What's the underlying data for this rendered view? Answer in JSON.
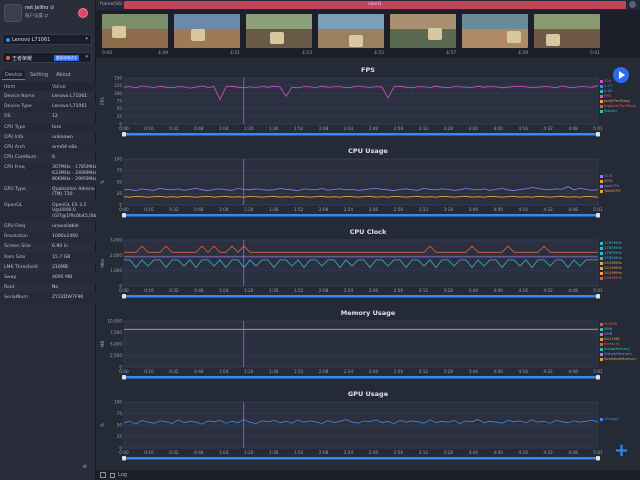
{
  "profile": {
    "name": "net Jeliho ⊙",
    "subtitle": "账户设置 ⇄"
  },
  "device_select": "Lenovo L71061",
  "app_select": "王者荣耀",
  "app_tag": "整游戏测试中",
  "tabs": [
    "Device",
    "Setting",
    "About"
  ],
  "table_header": {
    "item": "Item",
    "value": "Value"
  },
  "device_info": [
    {
      "k": "Device Name",
      "v": [
        "Lenovo L71061"
      ]
    },
    {
      "k": "Device Type",
      "v": [
        "Lenovo L71061"
      ]
    },
    {
      "k": "OS",
      "v": [
        "12"
      ]
    },
    {
      "k": "CPU Type",
      "v": [
        "toro"
      ]
    },
    {
      "k": "CPU Info",
      "v": [
        "unknown"
      ]
    },
    {
      "k": "CPU Arch",
      "v": [
        "arm64-v8a"
      ]
    },
    {
      "k": "CPU CoreNum",
      "v": [
        "8"
      ]
    },
    {
      "k": "CPU Freq",
      "v": [
        "307MHz - 1785MHz",
        "633MHz - 2496MHz",
        "806MHz - 2995MHz"
      ]
    },
    {
      "k": "GPU Type",
      "v": [
        "Qualcomm Adreno",
        "(TM) 730"
      ]
    },
    {
      "k": "OpenGL",
      "v": [
        "OpenGL ES 3.2",
        "V@0000.0",
        "(GIT@1f9c0b45,I0b4f"
      ]
    },
    {
      "k": "GPU Freq",
      "v": [
        "unavailable"
      ]
    },
    {
      "k": "Resolution",
      "v": [
        "1080x2460"
      ]
    },
    {
      "k": "Screen Size",
      "v": [
        "6.90 in"
      ]
    },
    {
      "k": "Ram Size",
      "v": [
        "15.7 GB"
      ]
    },
    {
      "k": "LMK Threshold",
      "v": [
        "216MB"
      ]
    },
    {
      "k": "Swap",
      "v": [
        "4095 MB"
      ]
    },
    {
      "k": "Root",
      "v": [
        "No"
      ]
    },
    {
      "k": "SerialNum",
      "v": [
        "ZY22DW7F9K"
      ]
    }
  ],
  "timeline": {
    "label": "frame(56)",
    "segment": "label1",
    "thumb_times": [
      "4:49",
      "4:51",
      "4:53",
      "4:55",
      "4:57",
      "4:59",
      "5:01"
    ],
    "offsets": [
      "0:00",
      "0:00"
    ]
  },
  "x_ticks": [
    "0:00",
    "0:16",
    "0:32",
    "0:48",
    "1:04",
    "1:20",
    "1:36",
    "1:52",
    "2:08",
    "2:24",
    "2:40",
    "2:56",
    "3:12",
    "3:28",
    "3:44",
    "4:00",
    "4:16",
    "4:32",
    "4:48",
    "5:01"
  ],
  "log_label": "Log",
  "chart_data": [
    {
      "type": "line",
      "title": "FPS",
      "ylabel": "FPS",
      "ylim": [
        0,
        150
      ],
      "yticks": [
        "150",
        "125",
        "100",
        "75",
        "50",
        "25",
        "0"
      ],
      "series": [
        {
          "name": "FPS",
          "color": "#d94fd2",
          "values": [
            120,
            122,
            118,
            124,
            121,
            119,
            123,
            120,
            118,
            122,
            121,
            117,
            120,
            124,
            119,
            122,
            80,
            121,
            123,
            120,
            118,
            121,
            119,
            122,
            120,
            123,
            121,
            90,
            120,
            118,
            122,
            121,
            119,
            123,
            120,
            121,
            122,
            118,
            120,
            124,
            121,
            119,
            122,
            120,
            85,
            121,
            123,
            120,
            118,
            122,
            121,
            119,
            123,
            120,
            118,
            122,
            121,
            120,
            119,
            123,
            120,
            122,
            121,
            118,
            120,
            122,
            123,
            121,
            119,
            120,
            122,
            121,
            118,
            124,
            120,
            119,
            122,
            121,
            120,
            125
          ]
        }
      ],
      "legend": [
        {
          "text": "120",
          "color": "#d94fd2"
        },
        {
          "text": "0.07",
          "color": "#2f8cf3"
        },
        {
          "text": "0.02",
          "color": "#2fc6a8"
        },
        {
          "text": "FPS",
          "color": "#d94fd2"
        },
        {
          "text": "Jank(PerfDog)",
          "color": "#f0a040"
        },
        {
          "text": "BigJank(PerfDog)",
          "color": "#e05555"
        },
        {
          "text": "Stutter",
          "color": "#2fc6a8"
        }
      ]
    },
    {
      "type": "line",
      "title": "CPU Usage",
      "ylabel": "%",
      "ylim": [
        0,
        100
      ],
      "yticks": [
        "100",
        "75",
        "50",
        "25",
        "0"
      ],
      "series": [
        {
          "name": "AppCPU",
          "color": "#8a7cf2",
          "values": [
            33,
            34,
            31,
            35,
            33,
            32,
            36,
            34,
            33,
            35,
            32,
            34,
            36,
            33,
            31,
            34,
            35,
            33,
            32,
            36,
            34,
            33,
            35,
            34,
            32,
            33,
            36,
            34,
            33,
            31,
            35,
            34,
            33,
            36,
            32,
            34,
            35,
            33,
            34,
            32,
            33,
            35,
            36,
            34,
            33,
            31,
            34,
            35,
            33,
            32,
            36,
            34,
            33,
            35,
            34,
            32,
            33,
            36,
            34,
            33,
            35,
            32,
            34,
            36,
            33,
            31,
            34,
            35,
            38,
            36,
            34,
            33,
            35,
            34,
            40,
            33,
            36,
            34,
            32,
            33
          ]
        },
        {
          "name": "TotalCPU",
          "color": "#f0a040",
          "values": [
            18,
            17,
            19,
            18,
            17,
            18,
            19,
            17,
            18,
            17,
            19,
            18,
            17,
            18,
            19,
            17,
            18,
            19,
            17,
            18,
            17,
            19,
            18,
            17,
            18,
            19,
            17,
            18,
            17,
            19,
            18,
            17,
            18,
            19,
            17,
            18,
            17,
            19,
            18,
            17,
            18,
            19,
            17,
            18,
            17,
            19,
            18,
            17,
            18,
            19,
            17,
            18,
            17,
            19,
            18,
            17,
            18,
            19,
            17,
            18,
            17,
            19,
            18,
            17,
            18,
            19,
            17,
            18,
            17,
            19,
            18,
            17,
            18,
            19,
            17,
            18,
            17,
            19,
            18,
            17
          ]
        }
      ],
      "legend": [
        {
          "text": "31%",
          "color": "#8a7cf2"
        },
        {
          "text": "20%",
          "color": "#f0a040"
        },
        {
          "text": "AppCPU",
          "color": "#8a7cf2"
        },
        {
          "text": "TotalCPU",
          "color": "#f0a040"
        }
      ]
    },
    {
      "type": "line",
      "title": "CPU Clock",
      "ylabel": "MHz",
      "ylim": [
        0,
        3000
      ],
      "yticks": [
        "3,000",
        "2,000",
        "1,000",
        "0"
      ],
      "series": [
        {
          "name": "CPU0",
          "color": "#e0663a",
          "values": [
            2200,
            2200,
            2200,
            2600,
            2200,
            2200,
            2200,
            2600,
            2200,
            2200,
            2200,
            2200,
            2200,
            2600,
            2200,
            2600,
            2200,
            2200,
            2600,
            2200,
            2600,
            2200,
            2200,
            2200,
            2200,
            2200,
            2200,
            2200,
            2200,
            2200,
            2200,
            2200,
            2200,
            2200,
            2200,
            2200,
            2200,
            2200,
            2200,
            2200,
            2200,
            2200,
            2200,
            2200,
            2200,
            2200,
            2200,
            2200,
            2200,
            2200,
            2200,
            2600,
            2200,
            2200,
            2200,
            2200,
            2200,
            2200,
            2600,
            2200,
            2200,
            2200,
            2200,
            2200,
            2600,
            2200,
            2200,
            2200,
            2200,
            2200,
            2600,
            2200,
            2200,
            2200,
            2200,
            2200,
            2200,
            2200,
            2200,
            2200
          ]
        },
        {
          "name": "CPU4",
          "color": "#2fb8d8",
          "values": [
            1700,
            1700,
            1200,
            1700,
            1300,
            1700,
            1700,
            1200,
            1700,
            1700,
            1300,
            1700,
            1200,
            1700,
            1700,
            1300,
            1700,
            1200,
            1700,
            1700,
            1200,
            1700,
            1300,
            1700,
            1700,
            1200,
            1700,
            1700,
            1300,
            1700,
            1200,
            1700,
            1700,
            1300,
            1700,
            1700,
            1200,
            1700,
            1300,
            1700,
            1700,
            1200,
            1700,
            1700,
            1300,
            1700,
            1700,
            1200,
            1700,
            1700,
            1300,
            1700,
            1200,
            1700,
            1700,
            1300,
            1700,
            1700,
            1200,
            1700,
            1300,
            1700,
            1700,
            1200,
            1700,
            1700,
            1300,
            1700,
            1200,
            1700,
            1700,
            1300,
            1700,
            1700,
            1200,
            1700,
            1300,
            1700,
            1700,
            1700
          ]
        },
        {
          "name": "CPU7",
          "color": "#9f7cf2",
          "values": [
            1900,
            1900,
            1900,
            1900,
            1900,
            1900,
            1900,
            1900,
            1900,
            1900,
            1900,
            1900,
            1900,
            1900,
            1900,
            1900,
            1900,
            1900,
            1900,
            1900,
            1900,
            1900,
            1900,
            1900,
            1900,
            1900,
            1900,
            1900,
            1900,
            1900,
            1900,
            1900,
            1900,
            1900,
            1900,
            1900,
            1900,
            1900,
            1900,
            1900,
            1900,
            1900,
            1900,
            1900,
            1900,
            1900,
            1900,
            1900,
            1900,
            1900,
            1900,
            1900,
            1900,
            1900,
            1900,
            1900,
            1900,
            1900,
            1900,
            1900,
            1900,
            1900,
            1900,
            1900,
            1900,
            1900,
            1900,
            1900,
            1900,
            1900,
            1900,
            1900,
            1900,
            1900,
            1900,
            1900,
            1900,
            1900,
            1900,
            1900
          ]
        }
      ],
      "legend": [
        {
          "text": "1785MHz",
          "color": "#2fb8d8"
        },
        {
          "text": "1785MHz",
          "color": "#2fb8d8"
        },
        {
          "text": "1785MHz",
          "color": "#2fb8d8"
        },
        {
          "text": "1785MHz",
          "color": "#2fb8d8"
        },
        {
          "text": "2419MHz",
          "color": "#f0a040"
        },
        {
          "text": "2419MHz",
          "color": "#f0a040"
        },
        {
          "text": "2419MHz",
          "color": "#f0a040"
        },
        {
          "text": "2995MHz",
          "color": "#e05555"
        }
      ]
    },
    {
      "type": "line",
      "title": "Memory Usage",
      "ylabel": "MB",
      "ylim": [
        0,
        10000
      ],
      "yticks": [
        "10,000",
        "7,500",
        "5,000",
        "2,500",
        "0"
      ],
      "series": [
        {
          "name": "Memory",
          "color": "#d9a73a",
          "values": [
            8200,
            8200,
            8200,
            8200,
            8200,
            8200,
            8200,
            8200,
            8200,
            8200,
            8200,
            8200,
            8200,
            8200,
            8200,
            8200,
            8200,
            8200,
            8200,
            8200,
            8200,
            8200,
            8200,
            8200,
            8200,
            8200,
            8200,
            8200,
            8200,
            8200,
            8200,
            8200,
            8200,
            8200,
            8200,
            8200,
            8200,
            8200,
            8200,
            8200,
            8200,
            8200,
            8200,
            8200,
            8200,
            8200,
            8200,
            8200,
            8200,
            8200,
            8200,
            8200,
            8200,
            8200,
            8200,
            8200,
            8200,
            8200,
            8200,
            8200,
            8200,
            8200,
            8200,
            8200,
            8200,
            8200,
            8200,
            8200,
            8200,
            8200,
            8200,
            8200,
            8200,
            8200,
            8200,
            8200,
            8200,
            8200,
            8200,
            8200
          ]
        }
      ],
      "legend": [
        {
          "text": "903MB",
          "color": "#e05555"
        },
        {
          "text": "0MB",
          "color": "#2fc6a8"
        },
        {
          "text": "0MB",
          "color": "#9f7cf2"
        },
        {
          "text": "8421MB",
          "color": "#d9a73a"
        },
        {
          "text": "Memory",
          "color": "#e05555"
        },
        {
          "text": "SwapMemory",
          "color": "#2fc6a8"
        },
        {
          "text": "VirtualMemory",
          "color": "#9f7cf2"
        },
        {
          "text": "AvailableMemory",
          "color": "#d9a73a"
        }
      ]
    },
    {
      "type": "line",
      "title": "GPU Usage",
      "ylabel": "%",
      "ylim": [
        0,
        100
      ],
      "yticks": [
        "100",
        "75",
        "50",
        "25",
        "0"
      ],
      "series": [
        {
          "name": "GUsage",
          "color": "#3a8be0",
          "values": [
            55,
            58,
            52,
            60,
            56,
            54,
            59,
            57,
            53,
            61,
            55,
            58,
            56,
            52,
            59,
            57,
            60,
            54,
            58,
            55,
            62,
            56,
            53,
            59,
            57,
            60,
            55,
            58,
            54,
            61,
            56,
            59,
            57,
            53,
            60,
            55,
            58,
            62,
            56,
            54,
            59,
            57,
            61,
            55,
            58,
            53,
            60,
            56,
            59,
            57,
            54,
            61,
            55,
            58,
            56,
            60,
            53,
            59,
            57,
            62,
            55,
            58,
            56,
            54,
            60,
            57,
            59,
            55,
            61,
            56,
            58,
            54,
            60,
            57,
            55,
            59,
            56,
            58,
            60,
            57
          ]
        }
      ],
      "legend": [
        {
          "text": "GUsage",
          "color": "#3a8be0"
        }
      ]
    }
  ]
}
